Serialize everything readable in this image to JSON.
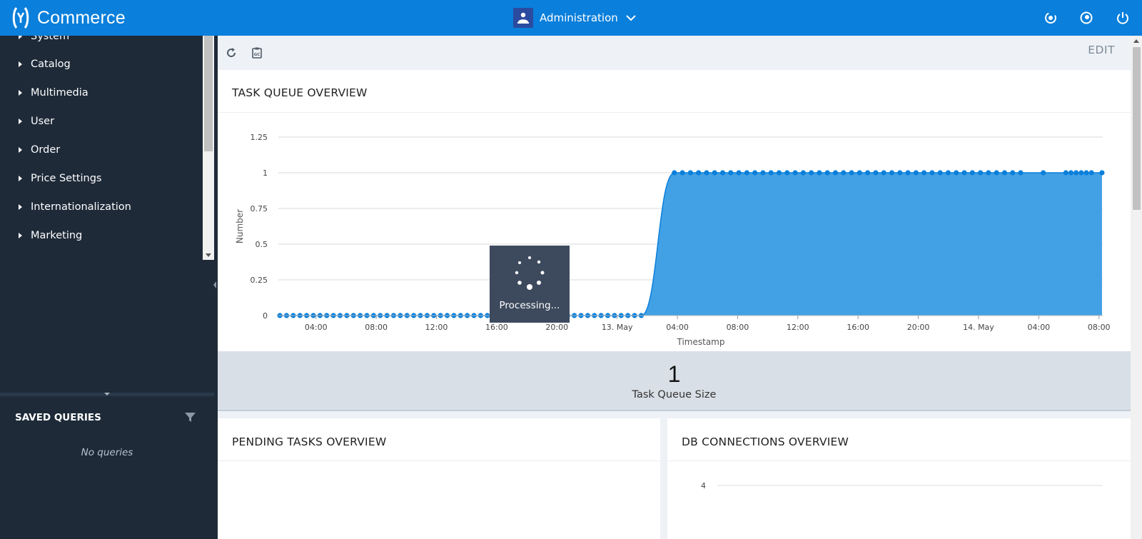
{
  "app": {
    "brand": "Commerce",
    "perspective": "Administration",
    "colors": {
      "topbar": "#0a7fdb",
      "sidebar": "#1e2a38",
      "chart_fill": "#42a1e5",
      "chart_line": "#0a7fdb"
    }
  },
  "header_icons": [
    "global-search-icon",
    "user-status-icon",
    "logout-icon"
  ],
  "sidebar": {
    "items": [
      {
        "label": "System"
      },
      {
        "label": "Catalog"
      },
      {
        "label": "Multimedia"
      },
      {
        "label": "User"
      },
      {
        "label": "Order"
      },
      {
        "label": "Price Settings"
      },
      {
        "label": "Internationalization"
      },
      {
        "label": "Marketing"
      }
    ],
    "saved_queries": {
      "title": "SAVED QUERIES",
      "empty": "No queries"
    }
  },
  "toolbar": {
    "edit_label": "EDIT"
  },
  "panels": {
    "task_queue": {
      "title": "TASK QUEUE OVERVIEW"
    },
    "task_queue_size": {
      "value": "1",
      "caption": "Task Queue Size"
    },
    "pending_tasks": {
      "title": "PENDING TASKS OVERVIEW"
    },
    "db_connections": {
      "title": "DB CONNECTIONS OVERVIEW"
    }
  },
  "processing": {
    "label": "Processing..."
  },
  "chart_data": [
    {
      "type": "area",
      "title": "",
      "xlabel": "Timestamp",
      "ylabel": "Number",
      "ylim": [
        0,
        1.25
      ],
      "yticks": [
        "0",
        "0.25",
        "0.5",
        "0.75",
        "1",
        "1.25"
      ],
      "xticks": [
        "04:00",
        "08:00",
        "12:00",
        "16:00",
        "20:00",
        "13. May",
        "04:00",
        "08:00",
        "12:00",
        "16:00",
        "20:00",
        "14. May",
        "04:00",
        "08:00"
      ],
      "xrange_hours": [
        1.5,
        56.25
      ],
      "grid": true,
      "series": [
        {
          "segments": [
            {
              "from_hour": 1.6,
              "to_hour": 25.6,
              "value": 0,
              "count": 55
            },
            {
              "from_hour": 27.8,
              "to_hour": 50.8,
              "value": 1,
              "count": 44
            },
            {
              "from_hour": 52.3,
              "to_hour": 52.3,
              "value": 1,
              "count": 1
            },
            {
              "from_hour": 53.8,
              "to_hour": 55.5,
              "value": 1,
              "count": 6
            },
            {
              "from_hour": 56.2,
              "to_hour": 56.2,
              "value": 1,
              "count": 1
            }
          ]
        }
      ]
    },
    {
      "type": "line",
      "title": "",
      "yticks": [
        "4"
      ],
      "grid": true
    }
  ]
}
